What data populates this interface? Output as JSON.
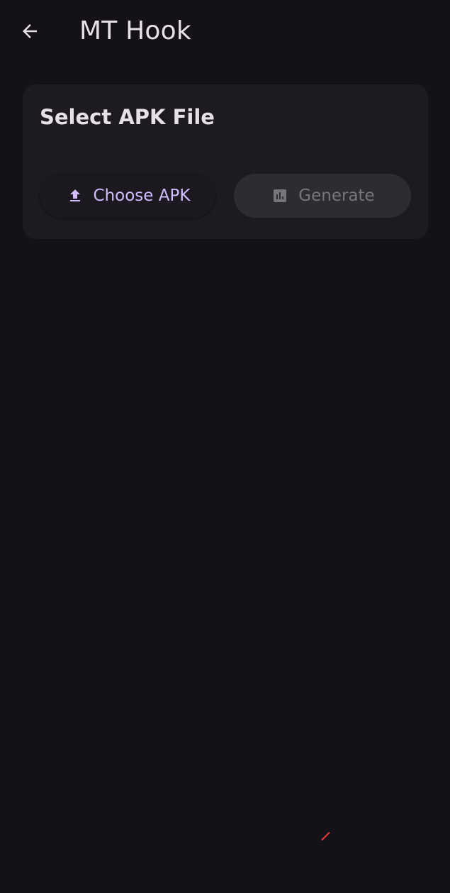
{
  "app_bar": {
    "title": "MT Hook",
    "back_icon": "arrow-left-icon"
  },
  "card": {
    "title": "Select APK File",
    "choose_button": {
      "label": "Choose APK",
      "icon": "upload-icon",
      "enabled": true
    },
    "generate_button": {
      "label": "Generate",
      "icon": "chart-icon",
      "enabled": false
    }
  },
  "colors": {
    "background": "#141218",
    "card": "#1d1b20",
    "on_surface": "#e6e0e9",
    "primary": "#d0bcff",
    "disabled_container": "#2e2c32",
    "disabled_content": "#78757c",
    "red_mark": "#e53935"
  }
}
